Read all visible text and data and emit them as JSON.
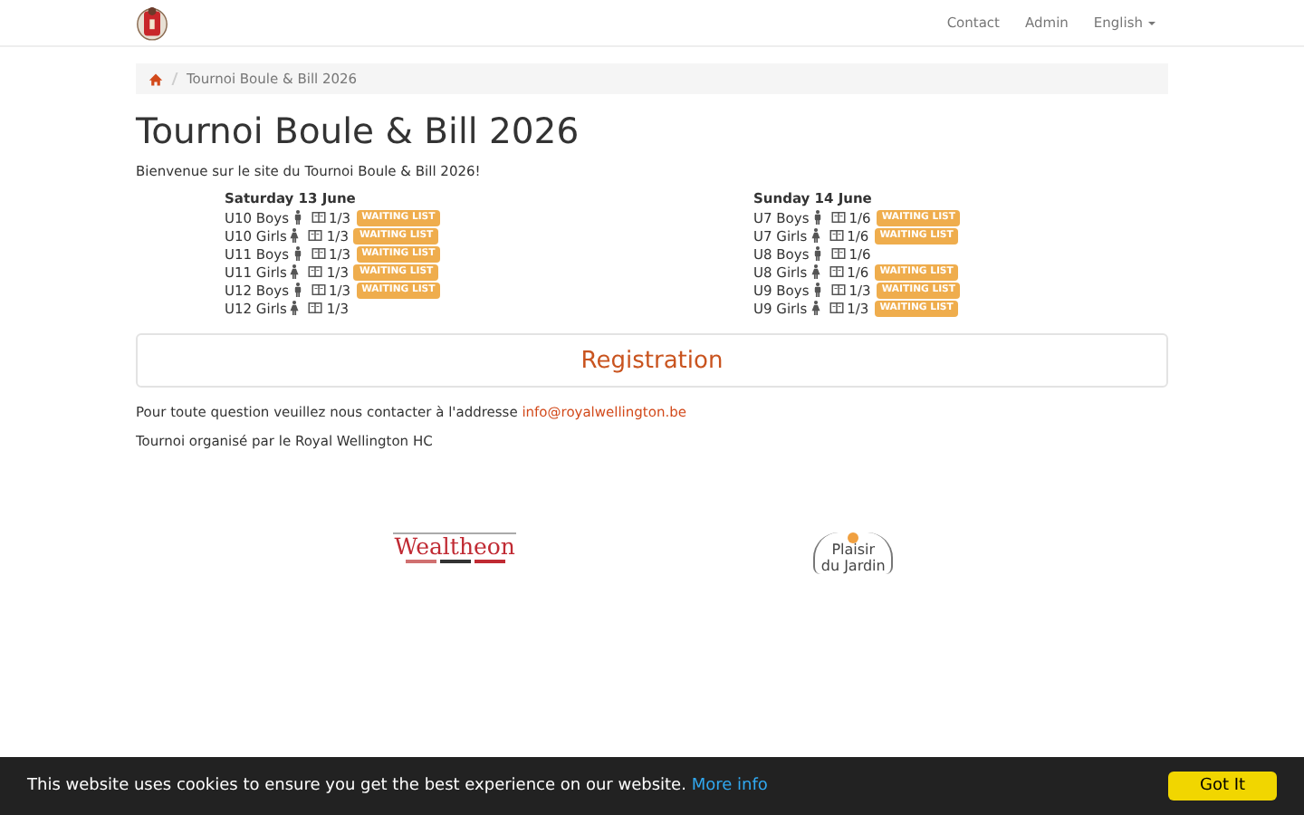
{
  "navbar": {
    "links": [
      "Contact",
      "Admin"
    ],
    "language": "English"
  },
  "breadcrumb": {
    "current": "Tournoi Boule & Bill 2026"
  },
  "title": "Tournoi Boule & Bill 2026",
  "intro": "Bienvenue sur le site du Tournoi Boule & Bill 2026!",
  "days": [
    {
      "title": "Saturday 13 June",
      "categories": [
        {
          "name": "U10 Boys",
          "kind": "boy",
          "teams": "1/3",
          "badge": "WAITING LIST"
        },
        {
          "name": "U10 Girls",
          "kind": "girl",
          "teams": "1/3",
          "badge": "WAITING LIST"
        },
        {
          "name": "U11 Boys",
          "kind": "boy",
          "teams": "1/3",
          "badge": "WAITING LIST"
        },
        {
          "name": "U11 Girls",
          "kind": "girl",
          "teams": "1/3",
          "badge": "WAITING LIST"
        },
        {
          "name": "U12 Boys",
          "kind": "boy",
          "teams": "1/3",
          "badge": "WAITING LIST"
        },
        {
          "name": "U12 Girls",
          "kind": "girl",
          "teams": "1/3"
        }
      ]
    },
    {
      "title": "Sunday 14 June",
      "categories": [
        {
          "name": "U7 Boys",
          "kind": "boy",
          "teams": "1/6",
          "badge": "WAITING LIST"
        },
        {
          "name": "U7 Girls",
          "kind": "girl",
          "teams": "1/6",
          "badge": "WAITING LIST"
        },
        {
          "name": "U8 Boys",
          "kind": "boy",
          "teams": "1/6"
        },
        {
          "name": "U8 Girls",
          "kind": "girl",
          "teams": "1/6",
          "badge": "WAITING LIST"
        },
        {
          "name": "U9 Boys",
          "kind": "boy",
          "teams": "1/3",
          "badge": "WAITING LIST"
        },
        {
          "name": "U9 Girls",
          "kind": "girl",
          "teams": "1/3",
          "badge": "WAITING LIST"
        }
      ]
    }
  ],
  "registration": "Registration",
  "contact": {
    "text": "Pour toute question veuillez nous contacter à l'addresse",
    "email": "info@royalwellington.be"
  },
  "organizer": "Tournoi organisé par le Royal Wellington HC",
  "sponsors": [
    {
      "kind": "wealtheon",
      "name": "Wealtheon"
    },
    {
      "kind": "jardin",
      "line1": "Plaisir",
      "line2": "du Jardin"
    }
  ],
  "cookie": {
    "text": "This website uses cookies to ensure you get the best experience on our website.",
    "link": "More info",
    "button": "Got It"
  }
}
